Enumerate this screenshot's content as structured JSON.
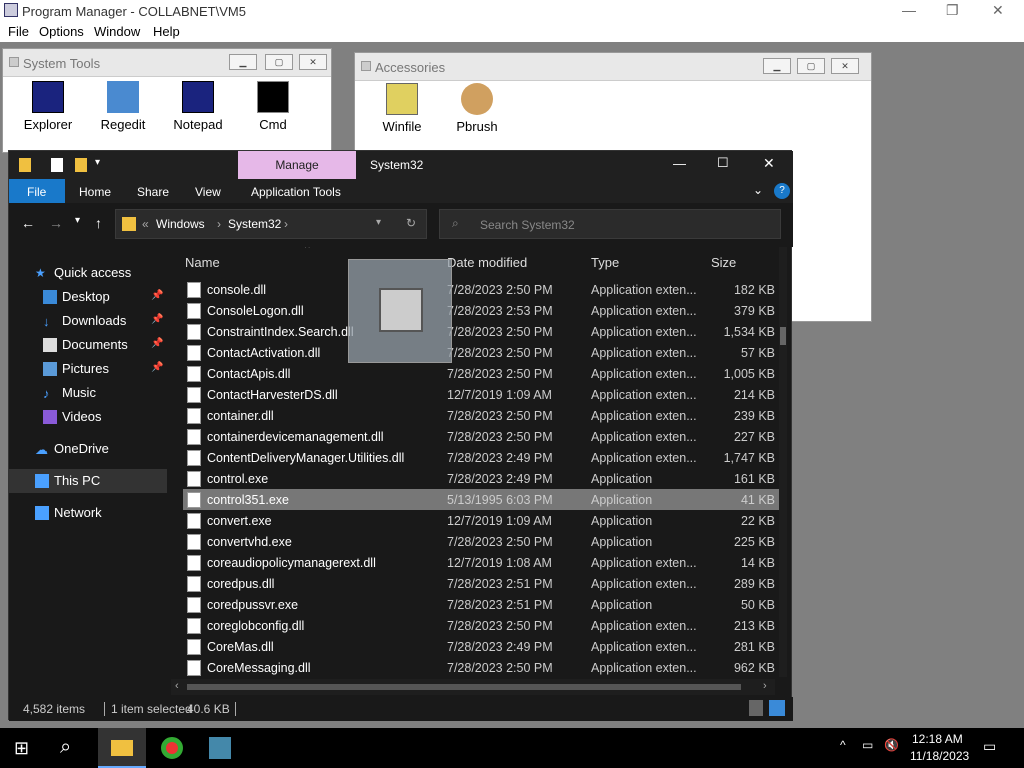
{
  "pm": {
    "title": "Program Manager - COLLABNET\\VM5",
    "menu": [
      "File",
      "Options",
      "Window",
      "Help"
    ]
  },
  "systools": {
    "title": "System Tools",
    "programs": [
      "Explorer",
      "Regedit",
      "Notepad",
      "Cmd"
    ]
  },
  "accessories": {
    "title": "Accessories",
    "programs": [
      "Winfile",
      "Pbrush"
    ]
  },
  "explorer": {
    "manage_tab": "Manage",
    "title": "System32",
    "ribbon": {
      "file": "File",
      "home": "Home",
      "share": "Share",
      "view": "View",
      "app_tools": "Application Tools"
    },
    "address": {
      "root": "Windows",
      "current": "System32"
    },
    "search_placeholder": "Search System32",
    "nav": [
      "Quick access",
      "Desktop",
      "Downloads",
      "Documents",
      "Pictures",
      "Music",
      "Videos",
      "OneDrive",
      "This PC",
      "Network"
    ],
    "columns": {
      "name": "Name",
      "date": "Date modified",
      "type": "Type",
      "size": "Size"
    },
    "files": [
      {
        "name": "console.dll",
        "date": "7/28/2023 2:50 PM",
        "type": "Application exten...",
        "size": "182 KB"
      },
      {
        "name": "ConsoleLogon.dll",
        "date": "7/28/2023 2:53 PM",
        "type": "Application exten...",
        "size": "379 KB"
      },
      {
        "name": "ConstraintIndex.Search.dll",
        "date": "7/28/2023 2:50 PM",
        "type": "Application exten...",
        "size": "1,534 KB"
      },
      {
        "name": "ContactActivation.dll",
        "date": "7/28/2023 2:50 PM",
        "type": "Application exten...",
        "size": "57 KB"
      },
      {
        "name": "ContactApis.dll",
        "date": "7/28/2023 2:50 PM",
        "type": "Application exten...",
        "size": "1,005 KB"
      },
      {
        "name": "ContactHarvesterDS.dll",
        "date": "12/7/2019 1:09 AM",
        "type": "Application exten...",
        "size": "214 KB"
      },
      {
        "name": "container.dll",
        "date": "7/28/2023 2:50 PM",
        "type": "Application exten...",
        "size": "239 KB"
      },
      {
        "name": "containerdevicemanagement.dll",
        "date": "7/28/2023 2:50 PM",
        "type": "Application exten...",
        "size": "227 KB"
      },
      {
        "name": "ContentDeliveryManager.Utilities.dll",
        "date": "7/28/2023 2:49 PM",
        "type": "Application exten...",
        "size": "1,747 KB"
      },
      {
        "name": "control.exe",
        "date": "7/28/2023 2:49 PM",
        "type": "Application",
        "size": "161 KB"
      },
      {
        "name": "control351.exe",
        "date": "5/13/1995 6:03 PM",
        "type": "Application",
        "size": "41 KB"
      },
      {
        "name": "convert.exe",
        "date": "12/7/2019 1:09 AM",
        "type": "Application",
        "size": "22 KB"
      },
      {
        "name": "convertvhd.exe",
        "date": "7/28/2023 2:50 PM",
        "type": "Application",
        "size": "225 KB"
      },
      {
        "name": "coreaudiopolicymanagerext.dll",
        "date": "12/7/2019 1:08 AM",
        "type": "Application exten...",
        "size": "14 KB"
      },
      {
        "name": "coredpus.dll",
        "date": "7/28/2023 2:51 PM",
        "type": "Application exten...",
        "size": "289 KB"
      },
      {
        "name": "coredpussvr.exe",
        "date": "7/28/2023 2:51 PM",
        "type": "Application",
        "size": "50 KB"
      },
      {
        "name": "coreglobconfig.dll",
        "date": "7/28/2023 2:50 PM",
        "type": "Application exten...",
        "size": "213 KB"
      },
      {
        "name": "CoreMas.dll",
        "date": "7/28/2023 2:49 PM",
        "type": "Application exten...",
        "size": "281 KB"
      },
      {
        "name": "CoreMessaging.dll",
        "date": "7/28/2023 2:50 PM",
        "type": "Application exten...",
        "size": "962 KB"
      }
    ],
    "selected_index": 10,
    "status": {
      "items": "4,582 items",
      "selected": "1 item selected",
      "size": "40.6 KB"
    }
  },
  "taskbar": {
    "time": "12:18 AM",
    "date": "11/18/2023"
  }
}
